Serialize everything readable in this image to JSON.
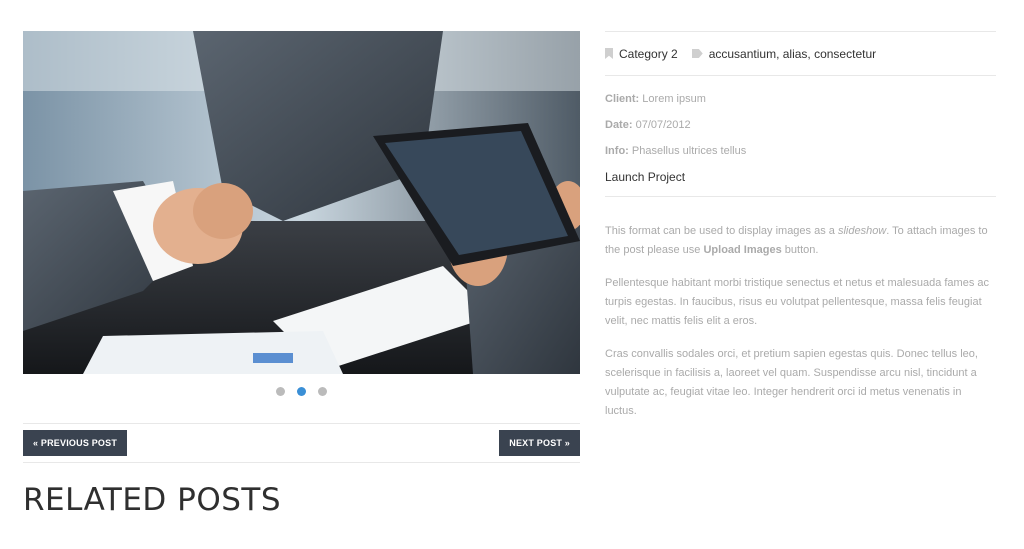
{
  "slider": {
    "image_name": "handshake-with-tablet-photo",
    "dots": [
      {
        "active": false
      },
      {
        "active": true
      },
      {
        "active": false
      }
    ]
  },
  "post_nav": {
    "previous_label": "« PREVIOUS POST",
    "next_label": "NEXT POST »"
  },
  "related_title": "RELATED POSTS",
  "meta": {
    "category": "Category 2",
    "tags": "accusantium, alias, consectetur",
    "client_label": "Client:",
    "client_value": "Lorem ipsum",
    "date_label": "Date:",
    "date_value": "07/07/2012",
    "info_label": "Info:",
    "info_value": "Phasellus ultrices tellus",
    "launch_label": "Launch Project"
  },
  "content": {
    "p1_a": "This format can be used to display images as a ",
    "p1_b": "slideshow",
    "p1_c": ". To attach images to the post please use ",
    "p1_d": "Upload Images",
    "p1_e": " button.",
    "p2": "Pellentesque habitant morbi tristique senectus et netus et malesuada fames ac turpis egestas. In faucibus, risus eu volutpat pellentesque, massa felis feugiat velit, nec mattis felis elit a eros.",
    "p3": "Cras convallis sodales orci, et pretium sapien egestas quis. Donec tellus leo, scelerisque in facilisis a, laoreet vel quam. Suspendisse arcu nisl, tincidunt a vulputate ac, feugiat vitae leo. Integer hendrerit orci id metus venenatis in luctus."
  },
  "colors": {
    "nav_button_bg": "#3a4350",
    "active_dot": "#3a8fd6",
    "heading": "#2f2f2f"
  }
}
